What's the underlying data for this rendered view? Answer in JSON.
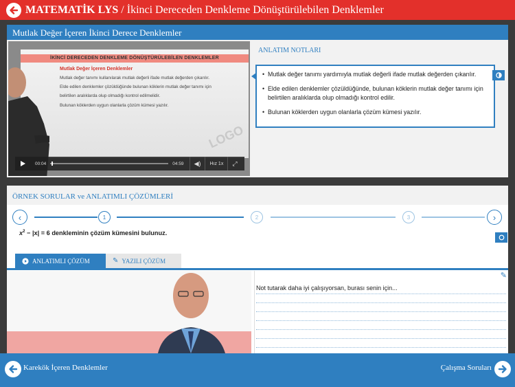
{
  "header": {
    "subject": "MATEMATİK LYS",
    "separator": " / ",
    "topic": "İkinci Dereceden Denkleme Dönüştürülebilen Denklemler"
  },
  "video_section": {
    "title": "Mutlak Değer İçeren İkinci Derece Denklemler",
    "slide": {
      "banner": "İKİNCİ DERECEDEN DENKLEME DÖNÜŞTÜRÜLEBİLEN DENKLEMLER",
      "subtitle": "Mutlak Değer İçeren Denklemler",
      "lines": [
        "Mutlak değer tanımı kullanılarak mutlak değerli ifade mutlak değerden çıkarılır.",
        "Elde edilen denklemler çözüldüğünde bulunan köklerin mutlak değer tanımı için",
        "belirtilen aralıklarda olup olmadığı kontrol edilmelidir.",
        "Bulunan köklerden uygun olanlarla çözüm kümesi yazılır."
      ],
      "logo": "LOGO"
    },
    "player": {
      "current_time": "00:04",
      "duration": "04:59",
      "speed": "Hız 1x",
      "progress": 0.01
    }
  },
  "notes": {
    "title": "ANLATIM NOTLARI",
    "items": [
      "Mutlak değer tanımı yardımıyla mutlak değerli ifade mutlak değerden çıkarılır.",
      "Elde edilen denklemler çözüldüğünde, bulunan köklerin mutlak değer tanımı için belirtilen aralıklarda olup olmadığı kontrol edilir.",
      "Bulunan köklerden uygun olanlarla çözüm kümesi yazılır."
    ]
  },
  "examples": {
    "title": "ÖRNEK SORULAR ve ANLATIMLI ÇÖZÜMLERİ",
    "steps": [
      "1",
      "2",
      "3"
    ],
    "question": {
      "var": "x",
      "exp": "2",
      "rest": " − |x| = 6 denkleminin çözüm kümesini bulunuz."
    },
    "tabs": {
      "video": "ANLATIMLI ÇÖZÜM",
      "written": "YAZILI ÇÖZÜM"
    },
    "notepad_text": "Not tutarak daha iyi çalışıyorsan, burası senin için..."
  },
  "footer": {
    "prev": "Karekök İçeren Denklemler",
    "next": "Çalışma Soruları"
  },
  "colors": {
    "header_red": "#e3302b",
    "primary_blue": "#2f7fc0"
  }
}
